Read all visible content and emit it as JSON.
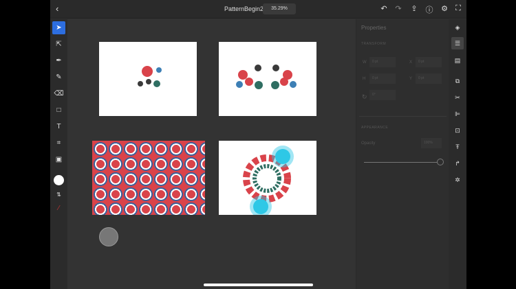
{
  "topbar": {
    "back": "‹",
    "title": "PatternBegin2",
    "zoom": "35.29%"
  },
  "properties": {
    "title": "Properties",
    "transform_label": "TRANSFORM",
    "w_label": "W",
    "w_value": "0 pt",
    "h_label": "H",
    "h_value": "0 pt",
    "x_label": "X",
    "x_value": "0 pt",
    "y_label": "Y",
    "y_value": "0 pt",
    "rotation_value": "0°",
    "appearance_label": "APPEARANCE",
    "opacity_label": "Opacity",
    "opacity_value": "100%",
    "opacity": 1.0
  },
  "colors": {
    "accent": "#2d6ee0",
    "pin_red": "#d9434a",
    "pin_teal": "#2f6e62",
    "pin_blue": "#3d7fb5",
    "pin_dark": "#3a3a3a",
    "cyan": "#2ec8e6"
  }
}
